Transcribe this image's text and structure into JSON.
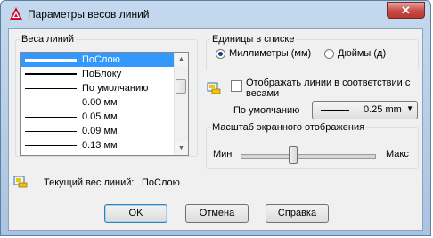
{
  "window": {
    "title": "Параметры весов линий",
    "close_label": "✕"
  },
  "lineweights": {
    "group_label": "Веса линий",
    "items": [
      {
        "label": "ПоСлою",
        "selected": true
      },
      {
        "label": "ПоБлоку",
        "selected": false
      },
      {
        "label": "По умолчанию",
        "selected": false
      },
      {
        "label": "0.00 мм",
        "selected": false
      },
      {
        "label": "0.05 мм",
        "selected": false
      },
      {
        "label": "0.09 мм",
        "selected": false
      },
      {
        "label": "0.13 мм",
        "selected": false
      }
    ]
  },
  "units": {
    "group_label": "Единицы в списке",
    "option_mm": "Миллиметры (мм)",
    "option_in": "Дюймы (д)",
    "selected": "mm"
  },
  "display": {
    "checkbox_label_line1": "Отображать линии в соответствии с",
    "checkbox_label_line2": "весами",
    "checked": false,
    "default_label": "По умолчанию",
    "default_value": "0.25 mm"
  },
  "scale": {
    "group_label": "Масштаб экранного отображения",
    "min_label": "Мин",
    "max_label": "Макс",
    "value": 0.39
  },
  "current": {
    "label": "Текущий вес линий:",
    "value": "ПоСлою"
  },
  "buttons": {
    "ok": "OK",
    "cancel": "Отмена",
    "help": "Справка"
  }
}
